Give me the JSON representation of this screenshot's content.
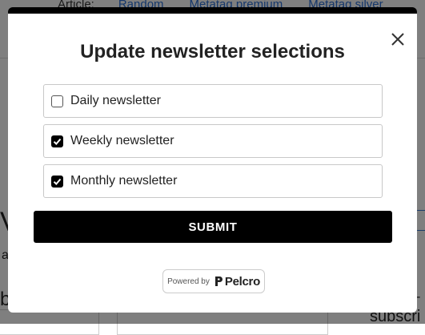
{
  "background": {
    "article_label": "Article:",
    "links": [
      "Random",
      "Metatag premium",
      "Metatag silver"
    ],
    "big_letter": "V",
    "small_letter": "a",
    "b_letter": "b",
    "right_box_text": "e",
    "dash": "-",
    "subscribe_text": "subscri"
  },
  "modal": {
    "title": "Update newsletter selections",
    "close_icon": "close-icon",
    "options": [
      {
        "label": "Daily newsletter",
        "checked": false
      },
      {
        "label": "Weekly newsletter",
        "checked": true
      },
      {
        "label": "Monthly newsletter",
        "checked": true
      }
    ],
    "submit_label": "SUBMIT",
    "powered_by": "Powered by",
    "brand": "Pelcro"
  },
  "colors": {
    "accent": "#000000",
    "overlay": "rgba(0,0,0,0.5)",
    "link": "#2a6fd6"
  }
}
